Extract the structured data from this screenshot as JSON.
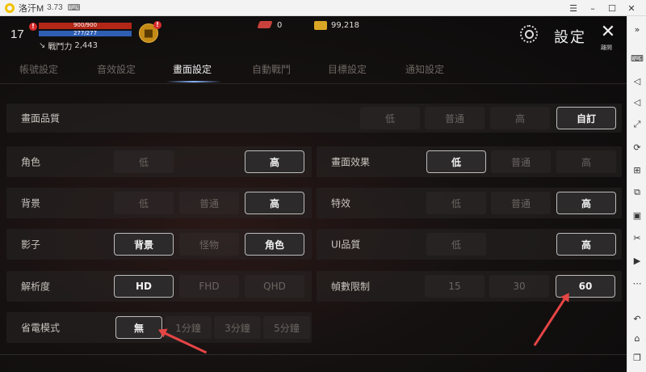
{
  "window": {
    "app_title": "洛汗M",
    "version": "3.73"
  },
  "hud": {
    "level": "17",
    "alert": "!",
    "hp": "900/900",
    "mp": "277/277",
    "power_label": "戰鬥力",
    "power_value": "2,443",
    "gem_count": "0",
    "gold_count": "99,218"
  },
  "header": {
    "title": "設定",
    "close_label": "離開"
  },
  "tabs": [
    {
      "label": "帳號設定"
    },
    {
      "label": "音效設定"
    },
    {
      "label": "畫面設定"
    },
    {
      "label": "自動戰鬥"
    },
    {
      "label": "目標設定"
    },
    {
      "label": "通知設定"
    }
  ],
  "settings": {
    "quality": {
      "label": "畫面品質",
      "options": [
        "低",
        "普通",
        "高",
        "自訂"
      ],
      "selected": "自訂"
    },
    "character": {
      "label": "角色",
      "options": [
        "低",
        "高"
      ],
      "selected": "高"
    },
    "screen_effect": {
      "label": "畫面效果",
      "options": [
        "低",
        "普通",
        "高"
      ],
      "selected": "低"
    },
    "background": {
      "label": "背景",
      "options": [
        "低",
        "普通",
        "高"
      ],
      "selected": "高"
    },
    "special_effect": {
      "label": "特效",
      "options": [
        "低",
        "普通",
        "高"
      ],
      "selected": "高"
    },
    "shadow": {
      "label": "影子",
      "options": [
        "背景",
        "怪物",
        "角色"
      ],
      "selected": [
        "背景",
        "角色"
      ]
    },
    "ui_quality": {
      "label": "UI品質",
      "options": [
        "低",
        "高"
      ],
      "selected": "高"
    },
    "resolution": {
      "label": "解析度",
      "options": [
        "HD",
        "FHD",
        "QHD"
      ],
      "selected": "HD"
    },
    "frame_limit": {
      "label": "幀數限制",
      "options": [
        "15",
        "30",
        "60"
      ],
      "selected": "60"
    },
    "power_save": {
      "label": "省電模式",
      "options": [
        "無",
        "1分鐘",
        "3分鐘",
        "5分鐘"
      ],
      "selected": "無"
    }
  },
  "colors": {
    "accent_red": "#e64545",
    "hp_bar": "#b32718",
    "mp_bar": "#2f5fb5"
  }
}
